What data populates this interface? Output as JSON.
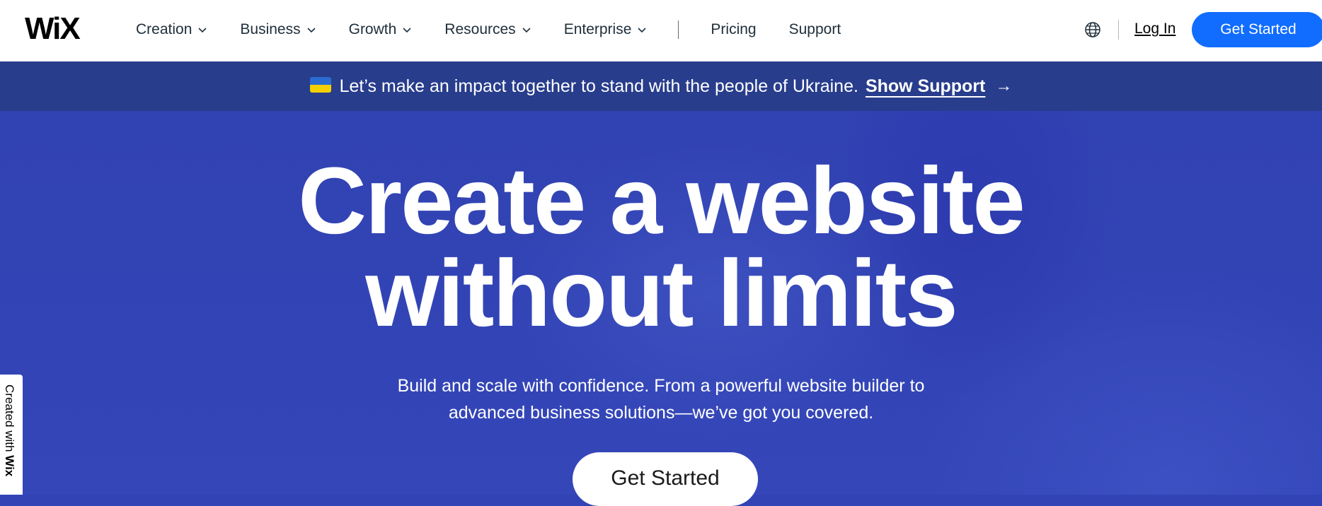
{
  "header": {
    "logo": "WiX",
    "nav": [
      {
        "label": "Creation"
      },
      {
        "label": "Business"
      },
      {
        "label": "Growth"
      },
      {
        "label": "Resources"
      },
      {
        "label": "Enterprise"
      }
    ],
    "nav_plain": [
      {
        "label": "Pricing"
      },
      {
        "label": "Support"
      }
    ],
    "login_label": "Log In",
    "cta_label": "Get Started",
    "cta_color": "#116dff"
  },
  "banner": {
    "text": "Let’s make an impact together to stand with the people of Ukraine.",
    "link_label": "Show Support",
    "arrow": "→",
    "background": "#283d8c"
  },
  "hero": {
    "title_line1": "Create a website",
    "title_line2": "without limits",
    "subtitle_line1": "Build and scale with confidence. From a powerful website builder to",
    "subtitle_line2": "advanced business solutions—we’ve got you covered.",
    "cta_label": "Get Started",
    "background": "#3244b5"
  },
  "badge": {
    "prefix": "Created with ",
    "brand": "Wix"
  },
  "icons": {
    "language": "globe-icon",
    "dropdown": "chevron-down-icon",
    "banner_flag": "ukraine-flag-icon",
    "banner_arrow": "arrow-right-icon"
  }
}
